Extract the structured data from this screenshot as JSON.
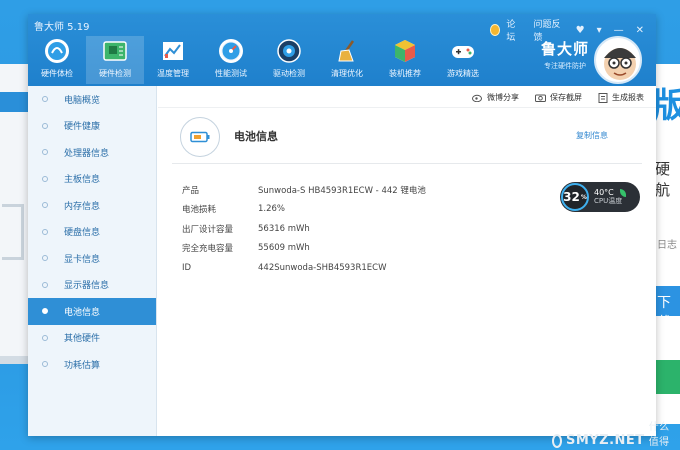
{
  "app": {
    "title": "鲁大师 5.19",
    "top_links": [
      "论坛",
      "问题反馈"
    ],
    "window_controls": [
      "♥",
      "▾",
      "—",
      "✕"
    ],
    "brand_name": "鲁大师",
    "brand_sub": "专注硬件防护"
  },
  "nav": [
    {
      "label": "硬件体检",
      "icon": "shield-gauge-icon"
    },
    {
      "label": "硬件检测",
      "icon": "circuit-board-icon"
    },
    {
      "label": "温度管理",
      "icon": "temperature-chart-icon"
    },
    {
      "label": "性能测试",
      "icon": "speedometer-icon"
    },
    {
      "label": "驱动检测",
      "icon": "gear-driver-icon"
    },
    {
      "label": "清理优化",
      "icon": "broom-icon"
    },
    {
      "label": "装机推荐",
      "icon": "cube-icon"
    },
    {
      "label": "游戏精选",
      "icon": "gamepad-icon"
    }
  ],
  "sidebar": [
    "电脑概览",
    "硬件健康",
    "处理器信息",
    "主板信息",
    "内存信息",
    "硬盘信息",
    "显卡信息",
    "显示器信息",
    "电池信息",
    "其他硬件",
    "功耗估算"
  ],
  "toolbar": {
    "share": "微博分享",
    "screenshot": "保存截屏",
    "report": "生成报表"
  },
  "section": {
    "title": "电池信息",
    "copy_label": "复制信息"
  },
  "properties": [
    {
      "label": "产品",
      "value": "Sunwoda-S HB4593R1ECW - 442 锂电池"
    },
    {
      "label": "电池损耗",
      "value": "1.26%"
    },
    {
      "label": "出厂设计容量",
      "value": "56316 mWh"
    },
    {
      "label": "完全充电容量",
      "value": "55609 mWh"
    },
    {
      "label": "ID",
      "value": "442Sunwoda-SHB4593R1ECW"
    }
  ],
  "cpu_widget": {
    "usage": "32",
    "usage_unit": "%",
    "temperature": "40°C",
    "label": "CPU温度"
  },
  "background": {
    "big_text": "版",
    "mid_text": "硬航",
    "small_text": "日志",
    "download": "下载"
  },
  "watermark": {
    "logo_text": "值",
    "text": "SMYZ.NET",
    "sub": "什么值得买"
  },
  "colors": {
    "accent": "#2f8fd6",
    "header": "#2a8fd8",
    "link": "#2f86cf"
  }
}
